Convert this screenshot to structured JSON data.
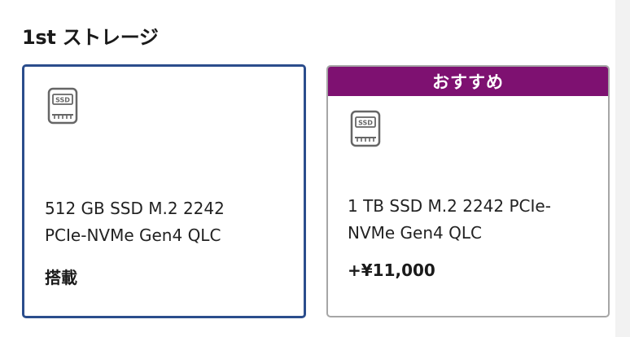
{
  "section": {
    "title": "1st ストレージ"
  },
  "options": [
    {
      "icon": "ssd-icon",
      "icon_label": "SSD",
      "name_line1": "512 GB SSD M.2 2242",
      "name_line2": "PCIe-NVMe Gen4 QLC",
      "price": "搭載",
      "selected": true
    },
    {
      "banner": "おすすめ",
      "icon": "ssd-icon",
      "icon_label": "SSD",
      "name_line1": "1 TB SSD M.2 2242 PCIe-",
      "name_line2": "NVMe Gen4 QLC",
      "price": "+¥11,000",
      "selected": false
    }
  ],
  "colors": {
    "selected_border": "#2b4d8c",
    "unselected_border": "#a6a6a6",
    "banner_bg": "#7e1171",
    "banner_text": "#ffffff"
  }
}
